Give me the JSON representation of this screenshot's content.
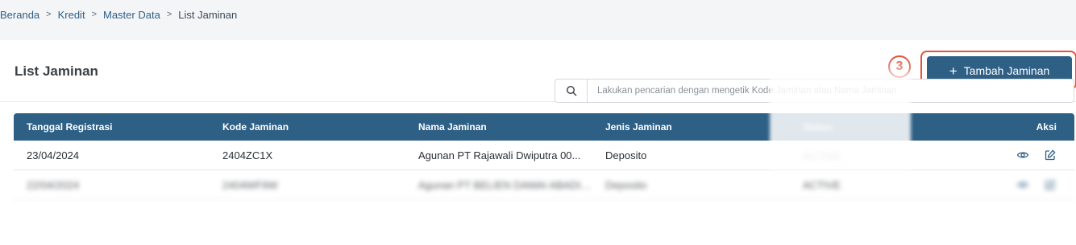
{
  "breadcrumb": {
    "items": [
      "Beranda",
      "Kredit",
      "Master Data",
      "List Jaminan"
    ],
    "separator": ">"
  },
  "page": {
    "title": "List Jaminan",
    "step_number": "3"
  },
  "toolbar": {
    "add_label": "Tambah Jaminan",
    "add_icon": "+"
  },
  "search": {
    "placeholder": "Lakukan pencarian dengan mengetik Kode Jaminan atau Nama Jaminan"
  },
  "table": {
    "headers": [
      "Tanggal Registrasi",
      "Kode Jaminan",
      "Nama Jaminan",
      "Jenis Jaminan",
      "Status",
      "Aksi"
    ],
    "rows": [
      {
        "tanggal": "23/04/2024",
        "kode": "2404ZC1X",
        "nama": "Agunan PT Rajawali Dwiputra 00...",
        "jenis": "Deposito",
        "status": "ACTIVE"
      },
      {
        "tanggal": "22/04/2024",
        "kode": "2404WF9W",
        "nama": "Agunan PT BELIEN DAMAI ABADI S...",
        "jenis": "Deposito",
        "status": "ACTIVE"
      }
    ]
  },
  "colors": {
    "accent": "#2e5f85",
    "highlight": "#e0533d",
    "link": "#2f5f86"
  },
  "icons": {
    "search": "search-icon",
    "view": "eye-icon",
    "edit": "edit-icon"
  }
}
